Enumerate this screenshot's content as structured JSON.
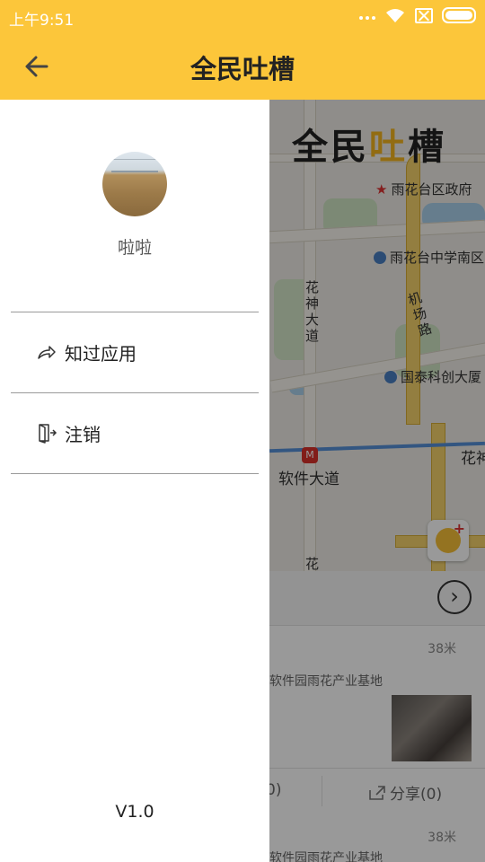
{
  "status_bar": {
    "time": "上午9:51"
  },
  "app_bar": {
    "title": "全民吐槽"
  },
  "drawer": {
    "username": "啦啦",
    "menu": [
      {
        "label": "知过应用",
        "icon": "share-icon"
      },
      {
        "label": "注销",
        "icon": "logout-icon"
      }
    ],
    "version": "V1.0"
  },
  "background": {
    "map": {
      "logo_left": "全民",
      "logo_mid": "吐",
      "logo_right": "槽",
      "pois": {
        "yuhuatai_gov": "雨花台区政府",
        "yuhuatai_school": "雨花台中学南区",
        "guotai": "国泰科创大厦",
        "software_road": "软件大道",
        "huashen_right": "花神"
      },
      "road_labels": {
        "huashen_avenue": "花神大道",
        "airport_road": "机场路",
        "hua_bottom": "花"
      }
    },
    "feed": [
      {
        "distance": "38米",
        "address": "软件园雨花产业基地",
        "left_count": "0)",
        "share": "分享(0)"
      },
      {
        "distance": "38米",
        "address": "软件园雨花产业基地"
      }
    ]
  },
  "colors": {
    "accent": "#fcc63a",
    "overlay": "rgba(0,0,0,0.4)"
  }
}
